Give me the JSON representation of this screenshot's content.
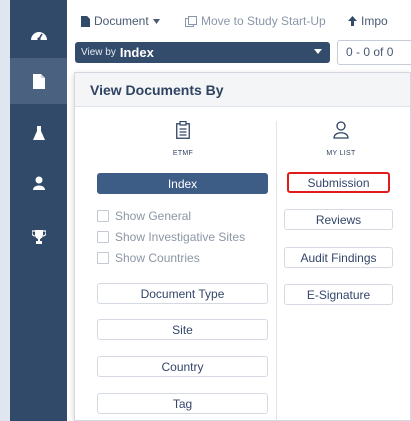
{
  "toolbar": {
    "document_menu": "Document",
    "move_label": "Move to Study Start-Up",
    "import_label": "Impo",
    "view_by_prefix": "View by",
    "view_by_value": "Index",
    "count_text": "0 - 0 of 0"
  },
  "rail": {
    "items": [
      {
        "icon": "dashboard-icon"
      },
      {
        "icon": "document-icon",
        "active": true
      },
      {
        "icon": "flask-icon"
      },
      {
        "icon": "user-icon"
      },
      {
        "icon": "trophy-icon"
      }
    ]
  },
  "panel": {
    "title": "View Documents By",
    "etmf": {
      "caption": "ETMF",
      "index_label": "Index",
      "checkboxes": [
        "Show General",
        "Show Investigative Sites",
        "Show Countries"
      ],
      "buttons": [
        "Document Type",
        "Site",
        "Country",
        "Tag"
      ]
    },
    "my_list": {
      "caption": "MY LIST",
      "buttons": [
        "Submission",
        "Reviews",
        "Audit Findings",
        "E-Signature"
      ]
    }
  },
  "colors": {
    "rail": "#324a6a",
    "primary": "#3d5c86",
    "highlight": "#e01b1b"
  }
}
